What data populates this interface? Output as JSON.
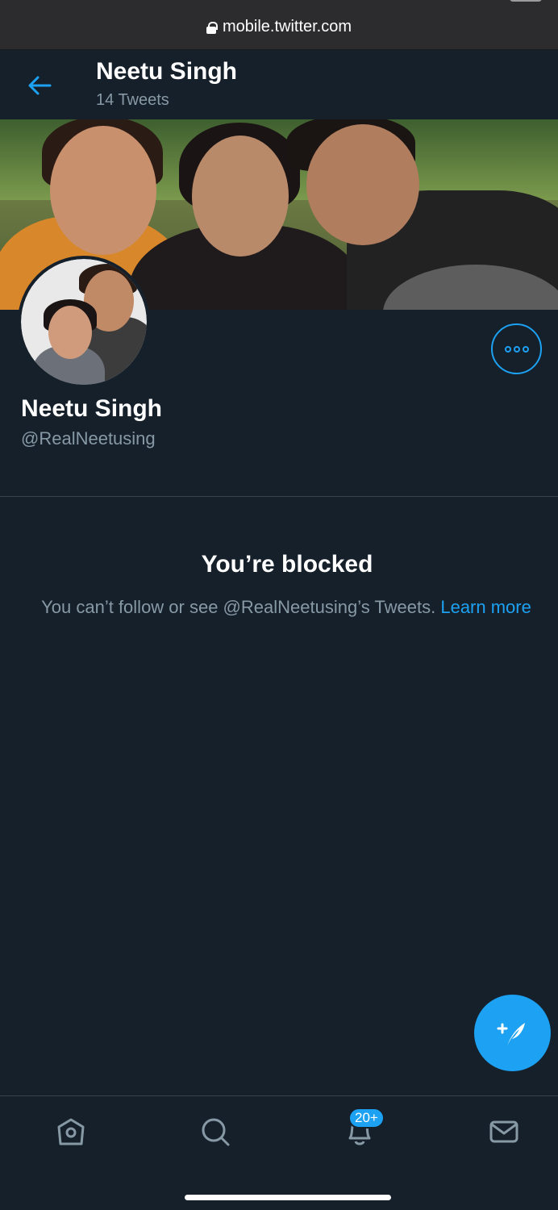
{
  "browser": {
    "url": "mobile.twitter.com"
  },
  "header": {
    "name": "Neetu Singh",
    "tweet_count": "14 Tweets"
  },
  "profile": {
    "name": "Neetu Singh",
    "handle": "@RealNeetusing"
  },
  "blocked": {
    "title": "You’re blocked",
    "message": "You can’t follow or see @RealNeetusing’s Tweets.",
    "link": "Learn more"
  },
  "nav": {
    "notification_badge": "20+"
  },
  "colors": {
    "background": "#15202b",
    "accent": "#1da1f2",
    "secondary_text": "#8899a6",
    "divider": "#38444d"
  },
  "icons": {
    "back": "back-arrow-icon",
    "more": "more-icon",
    "compose": "compose-tweet-icon",
    "home": "home-icon",
    "search": "search-icon",
    "notifications": "bell-icon",
    "messages": "mail-icon"
  }
}
